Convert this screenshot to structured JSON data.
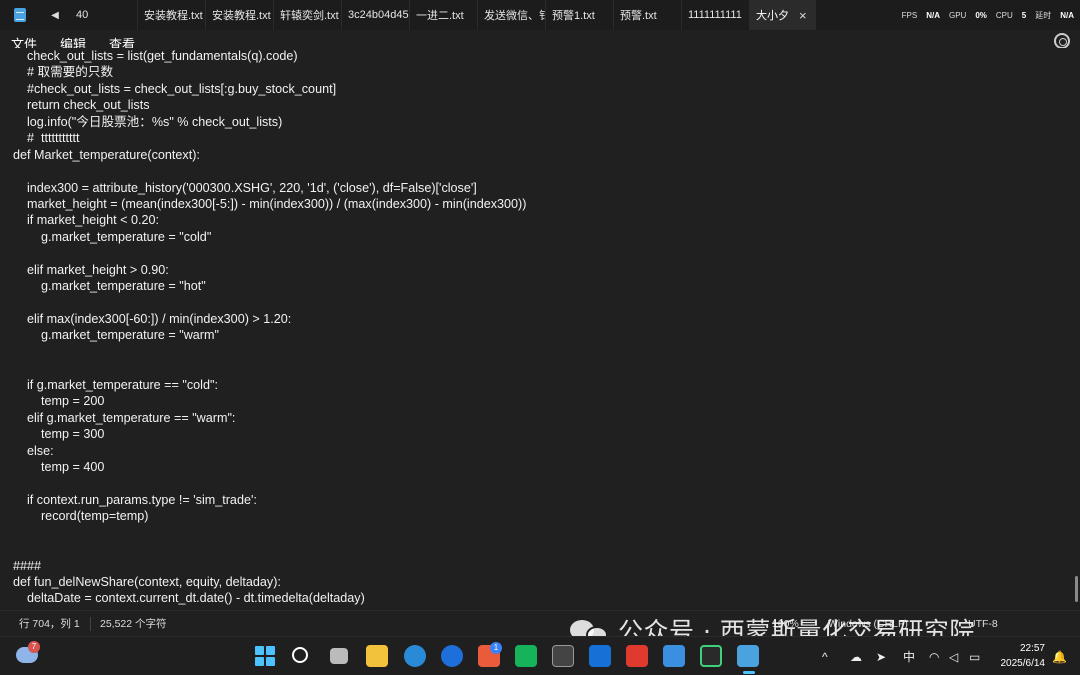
{
  "tabbar": {
    "nav_label": "◀",
    "tabs": [
      {
        "label": "40"
      },
      {
        "label": "安装教程.txt"
      },
      {
        "label": "安装教程.txt"
      },
      {
        "label": "轩辕奕剑.txt"
      },
      {
        "label": "3c24b04d45"
      },
      {
        "label": "一进二.txt"
      },
      {
        "label": "发送微信、钅"
      },
      {
        "label": "预警1.txt"
      },
      {
        "label": "预警.txt"
      },
      {
        "label": "1111111111"
      },
      {
        "label": "大小夕"
      }
    ],
    "close_glyph": "×",
    "overlay": {
      "fps_label": "FPS",
      "fps_value": "N/A",
      "gpu_label": "GPU",
      "gpu_value": "0%",
      "cpu_label": "CPU",
      "cpu_value": "5",
      "latency_label": "延时",
      "latency_value": "N/A"
    }
  },
  "menu": {
    "file": "文件",
    "edit": "编辑",
    "view": "查看"
  },
  "editor": {
    "lines": [
      "    check_out_lists = list(get_fundamentals(q).code)",
      "    # 取需要的只数",
      "    #check_out_lists = check_out_lists[:g.buy_stock_count]",
      "    return check_out_lists",
      "    log.info(\"今日股票池：%s\" % check_out_lists)",
      "    #  ttttttttttt",
      "def Market_temperature(context):",
      "",
      "    index300 = attribute_history('000300.XSHG', 220, '1d', ('close'), df=False)['close']",
      "    market_height = (mean(index300[-5:]) - min(index300)) / (max(index300) - min(index300))",
      "    if market_height < 0.20:",
      "        g.market_temperature = \"cold\"",
      "",
      "    elif market_height > 0.90:",
      "        g.market_temperature = \"hot\"",
      "",
      "    elif max(index300[-60:]) / min(index300) > 1.20:",
      "        g.market_temperature = \"warm\"",
      "",
      "",
      "    if g.market_temperature == \"cold\":",
      "        temp = 200",
      "    elif g.market_temperature == \"warm\":",
      "        temp = 300",
      "    else:",
      "        temp = 400",
      "",
      "    if context.run_params.type != 'sim_trade':",
      "        record(temp=temp)",
      "",
      "",
      "####",
      "def fun_delNewShare(context, equity, deltaday):",
      "    deltaDate = context.current_dt.date() - dt.timedelta(deltaday)"
    ]
  },
  "status": {
    "position": "行 704，列 1",
    "chars": "25,522 个字符",
    "zoom": "100%",
    "eol": "Windows (CRLF)",
    "encoding": "UTF-8"
  },
  "watermark": {
    "text": "公众号 · 西蒙斯量化交易研究院"
  },
  "taskbar": {
    "weather_badge": "7",
    "edge_badge": "1",
    "tray_chevron": "^",
    "ime": "中",
    "time": "22:57",
    "date": "2025/6/14"
  },
  "colors": {
    "background": "#202020",
    "text": "#f2f2f2",
    "accent": "#4cc2ff"
  }
}
